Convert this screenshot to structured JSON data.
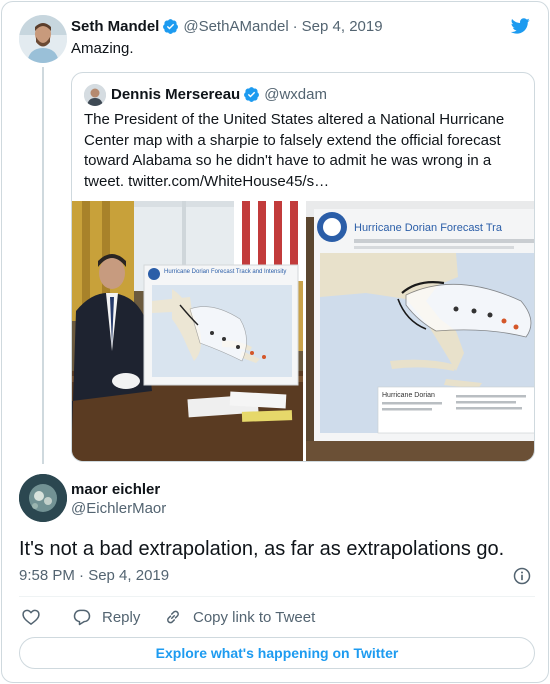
{
  "tweet": {
    "author_name": "Seth Mandel",
    "author_handle": "@SethAMandel",
    "date": "Sep 4, 2019",
    "text": "Amazing."
  },
  "quoted_tweet": {
    "author_name": "Dennis Mersereau",
    "author_handle": "@wxdam",
    "text": "The President of the United States altered a National Hurricane Center map with a sharpie to falsely extend the official forecast toward Alabama so he didn't have to admit he was wrong in a tweet. twitter.com/WhiteHouse45/s…",
    "media": {
      "left_map_title": "Hurricane Dorian Forecast Track and Intensity",
      "right_map_title": "Hurricane Dorian Forecast Tra",
      "right_map_label": "Hurricane Dorian"
    }
  },
  "reply": {
    "author_name": "maor eichler",
    "author_handle": "@EichlerMaor",
    "text": "It's not a bad extrapolation, as far as extrapolations go.",
    "timestamp": "9:58 PM · Sep 4, 2019"
  },
  "actions": {
    "reply_label": "Reply",
    "copy_link_label": "Copy link to Tweet"
  },
  "explore_label": "Explore what's happening on Twitter",
  "colors": {
    "twitter_blue": "#1d9bf0",
    "text_primary": "#0f1419",
    "text_secondary": "#536471",
    "border": "#cfd9de"
  },
  "icons": [
    "twitter-bird-icon",
    "verified-badge-icon",
    "info-icon",
    "heart-icon",
    "reply-icon",
    "link-icon"
  ]
}
